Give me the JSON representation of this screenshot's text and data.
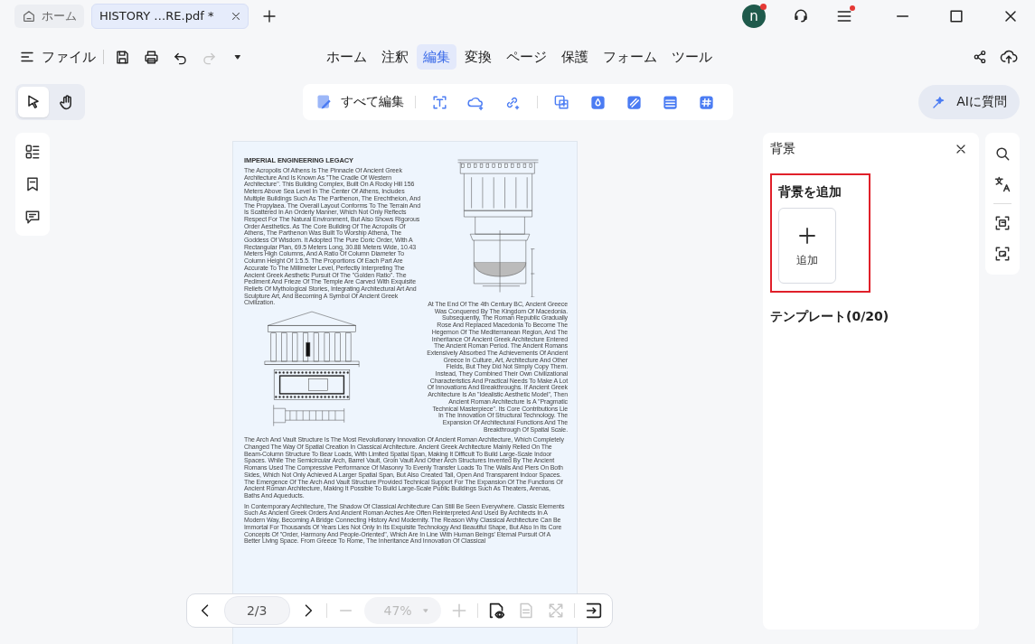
{
  "tabs": [
    {
      "kind": "home",
      "label": "ホーム",
      "selected": false
    },
    {
      "kind": "document",
      "label": "HISTORY …RE.pdf *",
      "selected": true
    }
  ],
  "account": {
    "initial": "n",
    "notification": true
  },
  "app_menu": {
    "notification": true
  },
  "file_menu": {
    "label": "ファイル"
  },
  "file_actions": [
    {
      "kind": "save",
      "disabled": false
    },
    {
      "kind": "print",
      "disabled": false
    },
    {
      "kind": "undo",
      "disabled": false
    },
    {
      "kind": "redo",
      "disabled": true
    }
  ],
  "main_menu": [
    {
      "label": "ホーム",
      "selected": false
    },
    {
      "label": "注釈",
      "selected": false
    },
    {
      "label": "編集",
      "selected": true
    },
    {
      "label": "変換",
      "selected": false
    },
    {
      "label": "ページ",
      "selected": false
    },
    {
      "label": "保護",
      "selected": false
    },
    {
      "label": "フォーム",
      "selected": false
    },
    {
      "label": "ツール",
      "selected": false
    }
  ],
  "tools": [
    {
      "kind": "select",
      "selected": true
    },
    {
      "kind": "hand",
      "selected": false
    }
  ],
  "edit_toolbar": {
    "edit_all": "すべて編集"
  },
  "ai_button": {
    "label": "AIに質問"
  },
  "document": {
    "title": "IMPERIAL ENGINEERING LEGACY",
    "paragraphs": [
      "The Acropolis Of Athens Is The Pinnacle Of Ancient Greek Architecture And Is Known As \"The Cradle Of Western Architecture\". This Building Complex, Built On A Rocky Hill 156 Meters Above Sea Level In The Center Of Athens, Includes Multiple Buildings Such As The Parthenon, The Erechtheion, And The Propylaea. The Overall Layout Conforms To The Terrain And Is Scattered In An Orderly Manner, Which Not Only Reflects Respect For The Natural Environment, But Also Shows Rigorous Order Aesthetics. As The Core Building Of The Acropolis Of Athens, The Parthenon Was Built To Worship Athena, The Goddess Of Wisdom. It Adopted The Pure Doric Order, With A Rectangular Plan, 69.5 Meters Long, 30.88 Meters Wide, 10.43 Meters High Columns, And A Ratio Of Column Diameter To Column Height Of 1:5.5. The Proportions Of Each Part Are Accurate To The Millimeter Level, Perfectly Interpreting The Ancient Greek Aesthetic Pursuit Of The \"Golden Ratio\". The Pediment And Frieze Of The Temple Are Carved With Exquisite Reliefs Of Mythological Stories, Integrating Architectural Art And Sculpture Art, And Becoming A Symbol Of Ancient Greek Civilization.",
      "At The End Of The 4th Century BC, Ancient Greece Was Conquered By The Kingdom Of Macedonia. Subsequently, The Roman Republic Gradually Rose And Replaced Macedonia To Become The Hegemon Of The Mediterranean Region, And The Inheritance Of Ancient Greek Architecture Entered The Ancient Roman Period. The Ancient Romans Extensively Absorbed The Achievements Of Ancient Greece In Culture, Art, Architecture And Other Fields, But They Did Not Simply Copy Them. Instead, They Combined Their Own Civilizational Characteristics And Practical Needs To Make A Lot Of Innovations And Breakthroughs. If Ancient Greek Architecture Is An \"Idealistic Aesthetic Model\", Then Ancient Roman Architecture Is A \"Pragmatic Technical Masterpiece\". Its Core Contributions Lie In The Innovation Of Structural Technology. The Expansion Of Architectural Functions And The Breakthrough Of Spatial Scale.",
      "The Arch And Vault Structure Is The Most Revolutionary Innovation Of Ancient Roman Architecture, Which Completely Changed The Way Of Spatial Creation In Classical Architecture. Ancient Greek Architecture Mainly Relied On The Beam-Column Structure To Bear Loads, With Limited Spatial Span, Making It Difficult To Build Large-Scale Indoor Spaces. While The Semicircular Arch, Barrel Vault, Groin Vault And Other Arch Structures Invented By The Ancient Romans Used The Compressive Performance Of Masonry To Evenly Transfer Loads To The Walls And Piers On Both Sides, Which Not Only Achieved A Larger Spatial Span, But Also Created Tall, Open And Transparent Indoor Spaces. The Emergence Of The Arch And Vault Structure Provided Technical Support For The Expansion Of The Functions Of Ancient Roman Architecture, Making It Possible To Build Large-Scale Public Buildings Such As Theaters, Arenas, Baths And Aqueducts.",
      "In Contemporary Architecture, The Shadow Of Classical Architecture Can Still Be Seen Everywhere. Classic Elements Such As Ancient Greek Orders And Ancient Roman Arches Are Often Reinterpreted And Used By Architects In A Modern Way, Becoming A Bridge Connecting History And Modernity. The Reason Why Classical Architecture Can Be Immortal For Thousands Of Years Lies Not Only In Its Exquisite Technology And Beautiful Shape, But Also In Its Core Concepts Of \"Order, Harmony And People-Oriented\", Which Are In Line With Human Beings' Eternal Pursuit Of A Better Living Space. From Greece To Rome, The Inheritance And Innovation Of Classical"
    ]
  },
  "side_panel": {
    "title": "背景",
    "add_heading": "背景を追加",
    "add_label": "追加",
    "templates": "テンプレート(0/20)"
  },
  "pager": {
    "page": "2/3",
    "zoom": "47%",
    "zoom_disabled": true
  }
}
